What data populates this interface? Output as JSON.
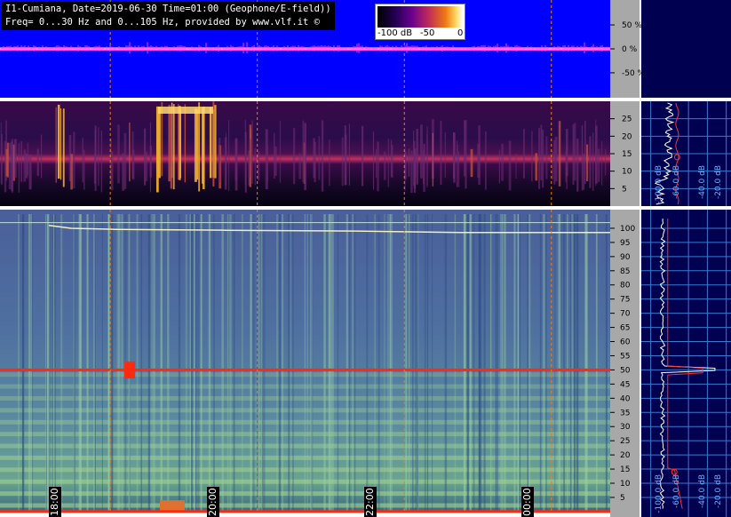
{
  "header": {
    "line1": "I1-Cumiana, Date=2019-06-30 Time=01:00 (Geophone/E-field))",
    "line2": "Freq= 0...30 Hz and 0...105 Hz, provided by www.vlf.it ©"
  },
  "colorbar": {
    "labels": [
      "-100 dB",
      "-50",
      "0"
    ]
  },
  "colors": {
    "waveform_bg": "#0000ff",
    "waveform_trace": "#ff40ff",
    "grid_dash": "#e08030",
    "profile_bg": "#000050",
    "profile_grid": "#3a7ad0",
    "profile_trace": "#ffffff",
    "profile_median": "#ff3030",
    "mains_line": "#ff2a10"
  },
  "chart_data": [
    {
      "type": "line",
      "panel": "waveform",
      "ylabels": [
        "50 %",
        "0 %",
        "-50 %"
      ],
      "yticks": [
        50,
        0,
        -50
      ],
      "ylim": [
        -100,
        100
      ]
    },
    {
      "type": "heatmap",
      "panel": "spectrogram-low",
      "ylim": [
        0,
        30
      ],
      "yticks": [
        5,
        10,
        15,
        20,
        25
      ],
      "ylabels": [
        "5",
        "10",
        "15",
        "20",
        "25"
      ]
    },
    {
      "type": "heatmap",
      "panel": "spectrogram-high",
      "ylim": [
        0,
        105
      ],
      "yticks": [
        5,
        10,
        15,
        20,
        25,
        30,
        35,
        40,
        45,
        50,
        55,
        60,
        65,
        70,
        75,
        80,
        85,
        90,
        95,
        100
      ],
      "ylabels": [
        "5",
        "10",
        "15",
        "20",
        "25",
        "30",
        "35",
        "40",
        "45",
        "50",
        "55",
        "60",
        "65",
        "70",
        "75",
        "80",
        "85",
        "90",
        "95",
        "100"
      ],
      "hum_line_hz": 50
    },
    {
      "type": "line",
      "panel": "profile-low",
      "xticks": [
        -100,
        -60,
        -40,
        -20
      ],
      "xlabels": [
        "-100.0 dB",
        "-60.0 dB",
        "-40.0 dB",
        "-20.0 dB"
      ],
      "ylim": [
        0,
        30
      ]
    },
    {
      "type": "line",
      "panel": "profile-high",
      "xticks": [
        -100,
        -60,
        -40,
        -20
      ],
      "xlabels": [
        "-100.0 dB",
        "-60.0 dB",
        "-40.0 dB",
        "-20.0 dB"
      ],
      "ylim": [
        0,
        105
      ]
    }
  ],
  "time_axis": {
    "labels": [
      "18:00",
      "20:00",
      "22:00",
      "00:00"
    ],
    "hours": [
      18,
      20,
      22,
      24
    ],
    "range": [
      16.5,
      24.8
    ]
  }
}
